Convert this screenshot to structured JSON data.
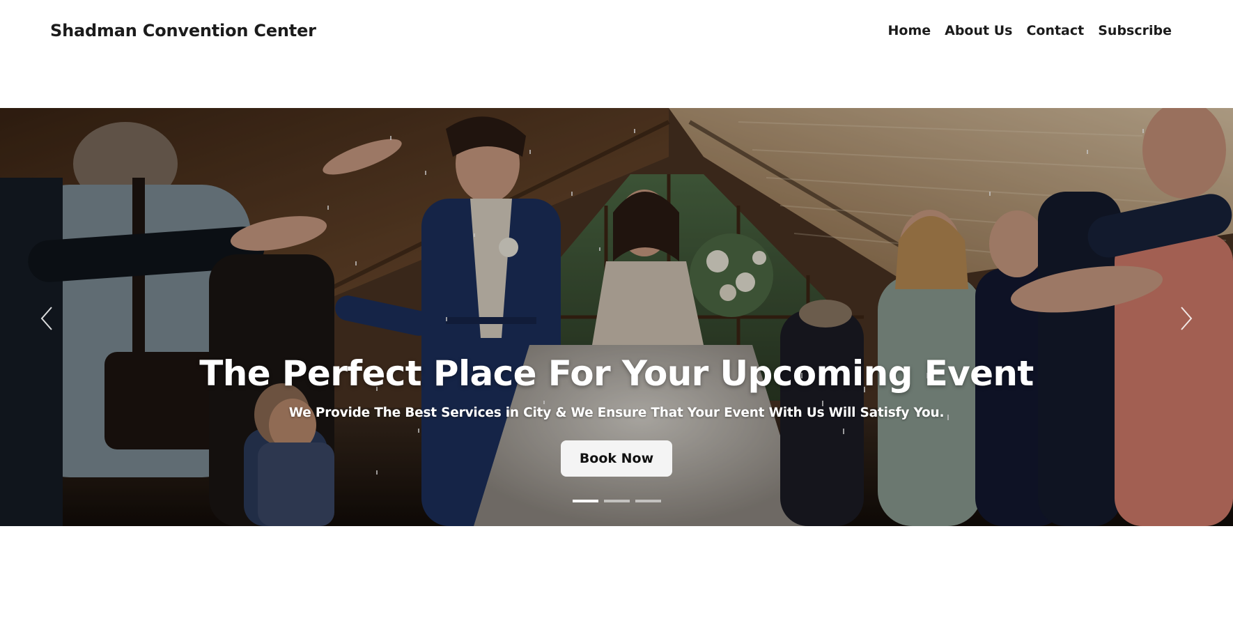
{
  "header": {
    "brand": "Shadman Convention Center",
    "nav": [
      {
        "label": "Home"
      },
      {
        "label": "About Us"
      },
      {
        "label": "Contact"
      },
      {
        "label": "Subscribe"
      }
    ]
  },
  "hero": {
    "title": "The Perfect Place For Your Upcoming Event",
    "subtitle": "We Provide The Best Services in City & We Ensure That Your Event With Us Will Satisfy You.",
    "cta_label": "Book Now",
    "slide_count": 3,
    "active_slide": 1,
    "prev_icon": "chevron-left-icon",
    "next_icon": "chevron-right-icon"
  },
  "colors": {
    "text": "#1b1b1b",
    "hero_text": "#ffffff",
    "button_bg": "#f4f4f4"
  }
}
